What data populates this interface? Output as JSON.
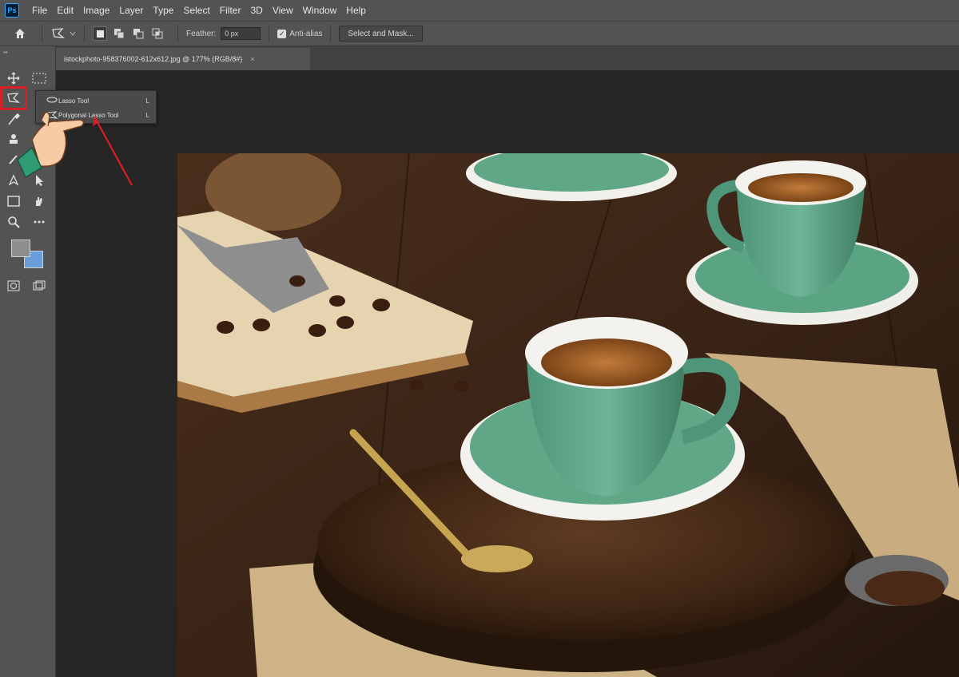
{
  "menu": {
    "logo": "Ps",
    "items": [
      "File",
      "Edit",
      "Image",
      "Layer",
      "Type",
      "Select",
      "Filter",
      "3D",
      "View",
      "Window",
      "Help"
    ]
  },
  "options": {
    "feather_label": "Feather:",
    "feather_value": "0 px",
    "antialias_label": "Anti-alias",
    "select_mask_label": "Select and Mask..."
  },
  "document": {
    "tab_title": "istockphoto-958376002-612x612.jpg @ 177% (RGB/8#)",
    "close": "×"
  },
  "flyout": {
    "items": [
      {
        "label": "Lasso Tool",
        "shortcut": "L"
      },
      {
        "label": "Polygonal Lasso Tool",
        "shortcut": "L"
      }
    ]
  },
  "colors": {
    "foreground": "#8e8e8e",
    "background": "#6a9ed9",
    "highlight": "#d91e26"
  },
  "icons": [
    "home-icon",
    "lasso-icon",
    "move-icon",
    "marquee-icon",
    "eyedropper-icon",
    "brush-icon",
    "stamp-icon",
    "pen-icon",
    "select-arrow-icon",
    "rectangle-icon",
    "hand-icon",
    "zoom-icon",
    "more-icon"
  ]
}
